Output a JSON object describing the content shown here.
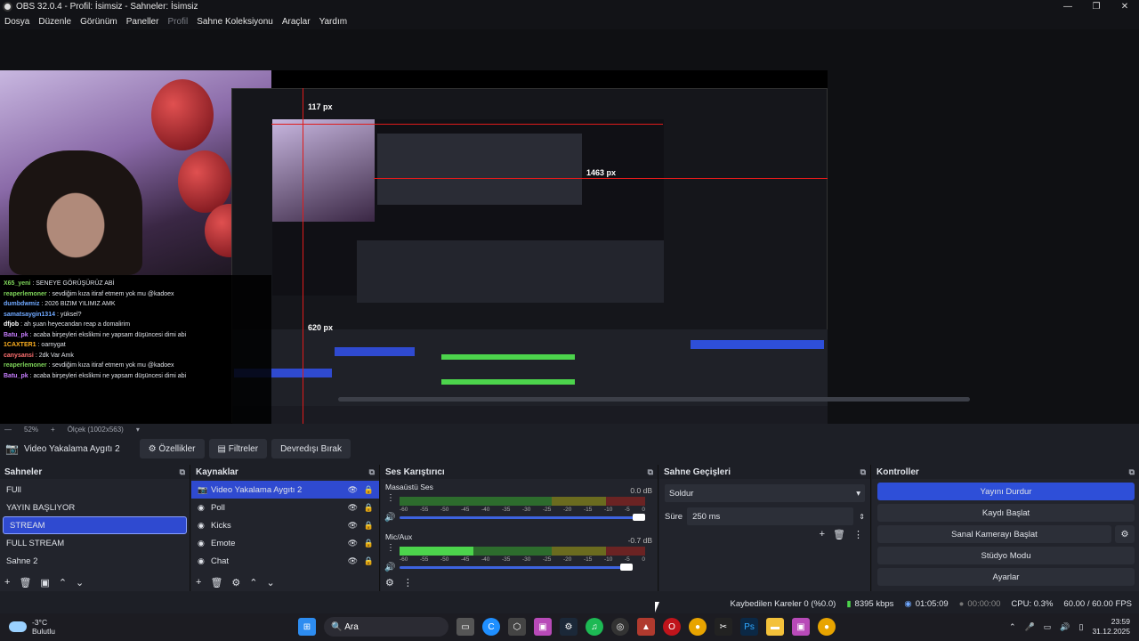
{
  "window": {
    "title": "OBS 32.0.4 - Profil: İsimsiz - Sahneler: İsimsiz",
    "controls": [
      "—",
      "❐",
      "✕"
    ]
  },
  "menu": [
    "Dosya",
    "Düzenle",
    "Görünüm",
    "Paneller",
    "Profil",
    "Sahne Koleksiyonu",
    "Araçlar",
    "Yardım"
  ],
  "preview": {
    "labels": [
      "117 px",
      "1463 px",
      "620 px"
    ],
    "zoom": "52%",
    "scale": "Ölçek (1002x563)",
    "chat": [
      {
        "user": "X65_yeni",
        "color": "#7fd65a",
        "text": ": SENEYE GÖRÜŞÜRÜZ ABİ"
      },
      {
        "user": "reaperlemoner",
        "color": "#7fd65a",
        "text": ": sevdiğim kıza itiraf etmem yok mu @kadoex"
      },
      {
        "user": "dumbdwmiz",
        "color": "#6fa8ff",
        "text": ": 2026 BIZIM YILIMIZ AMK"
      },
      {
        "user": "samatsaygin1314",
        "color": "#6fa8ff",
        "text": ": yüksel?"
      },
      {
        "user": "dfjob",
        "color": "#ffffff",
        "text": ": ah şuan heyecandan reap a domalirim"
      },
      {
        "user": "Batu_pk",
        "color": "#c77dff",
        "text": ": acaba birşeyleri ekslikmi ne yapsam düşüncesi dimi abi"
      },
      {
        "user": "1CAXTER1",
        "color": "#ffb020",
        "text": ": oarnygat"
      },
      {
        "user": "canysansi",
        "color": "#ff7070",
        "text": ": 2dk Var Amk"
      },
      {
        "user": "reaperlemoner",
        "color": "#7fd65a",
        "text": ": sevdiğim kıza itiraf etmem yok mu @kadoex"
      },
      {
        "user": "Batu_pk",
        "color": "#c77dff",
        "text": ": acaba birşeyleri ekslikmi ne yapsam düşüncesi dimi abi"
      }
    ]
  },
  "props_bar": {
    "source_name": "Video Yakalama Aygıtı 2",
    "properties": "Özellikler",
    "filters": "Filtreler",
    "deactivate": "Devredışı Bırak"
  },
  "scenes": {
    "title": "Sahneler",
    "items": [
      "FUll",
      "YAYIN BAŞLIYOR",
      "STREAM",
      "FULL STREAM",
      "Sahne 2"
    ],
    "selected": 2
  },
  "sources": {
    "title": "Kaynaklar",
    "items": [
      {
        "label": "Video Yakalama Aygıtı 2",
        "icon": "camera-icon"
      },
      {
        "label": "Poll",
        "icon": "globe-icon"
      },
      {
        "label": "Kicks",
        "icon": "globe-icon"
      },
      {
        "label": "Emote",
        "icon": "globe-icon"
      },
      {
        "label": "Chat",
        "icon": "globe-icon"
      }
    ]
  },
  "mixer": {
    "title": "Ses Karıştırıcı",
    "channels": [
      {
        "name": "Masaüstü Ses",
        "db": "0.0 dB",
        "level": 0.0,
        "volume": 1.0
      },
      {
        "name": "Mic/Aux",
        "db": "-0.7 dB",
        "level": 0.3,
        "volume": 0.96
      }
    ],
    "ticks": [
      "-60",
      "-55",
      "-50",
      "-45",
      "-40",
      "-35",
      "-30",
      "-25",
      "-20",
      "-15",
      "-10",
      "-5",
      "0"
    ]
  },
  "transitions": {
    "title": "Sahne Geçişleri",
    "selected": "Soldur",
    "duration_label": "Süre",
    "duration": "250 ms"
  },
  "controls": {
    "title": "Kontroller",
    "buttons": [
      "Yayını Durdur",
      "Kaydı Başlat",
      "Sanal Kamerayı Başlat",
      "Stüdyo Modu",
      "Ayarlar"
    ]
  },
  "status": {
    "dropped": "Kaybedilen Kareler 0 (%0.0)",
    "bitrate": "8395 kbps",
    "stream_time": "01:05:09",
    "rec_time": "00:00:00",
    "cpu": "CPU: 0.3%",
    "fps": "60.00 / 60.00 FPS"
  },
  "taskbar": {
    "temp": "-3°C",
    "weather": "Bulutlu",
    "search": "Ara",
    "time": "23:59",
    "date": "31.12.2025"
  }
}
